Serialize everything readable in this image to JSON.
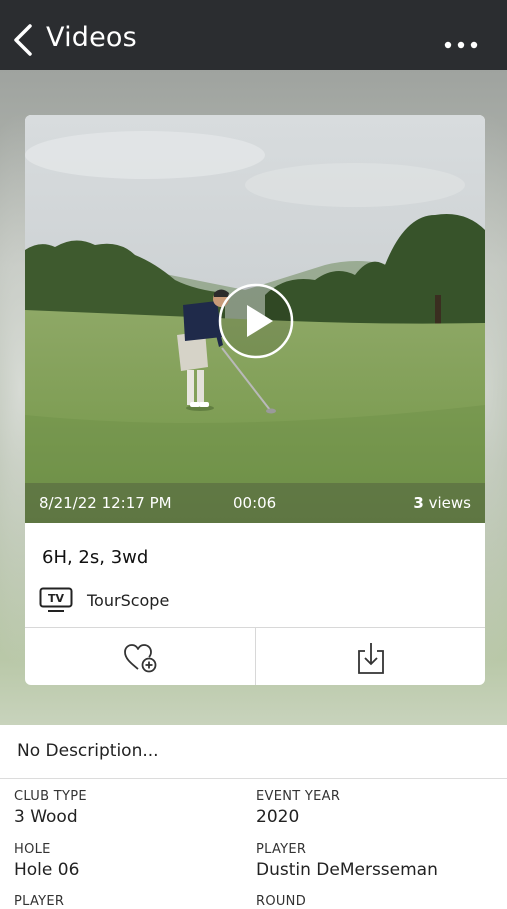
{
  "header": {
    "title": "Videos",
    "back_icon": "chevron-left-icon",
    "more_icon": "more-horizontal-icon"
  },
  "video": {
    "date": "8/21/22 12:17 PM",
    "duration": "00:06",
    "views_count": "3",
    "views_label": "views",
    "title": "6H, 2s, 3wd",
    "source_icon": "tv-icon",
    "source": "TourScope",
    "play_icon": "play-icon"
  },
  "actions": {
    "favorite_icon": "heart-add-icon",
    "download_icon": "download-icon"
  },
  "description": "No Description...",
  "details": [
    {
      "label": "CLUB TYPE",
      "value": "3 Wood"
    },
    {
      "label": "EVENT YEAR",
      "value": "2020"
    },
    {
      "label": "HOLE",
      "value": "Hole 06"
    },
    {
      "label": "PLAYER",
      "value": "Dustin DeMersseman"
    },
    {
      "label": "PLAYER",
      "value": ""
    },
    {
      "label": "ROUND",
      "value": ""
    }
  ],
  "colors": {
    "header_bg": "#2b2d30",
    "header_text": "#ffffff"
  }
}
